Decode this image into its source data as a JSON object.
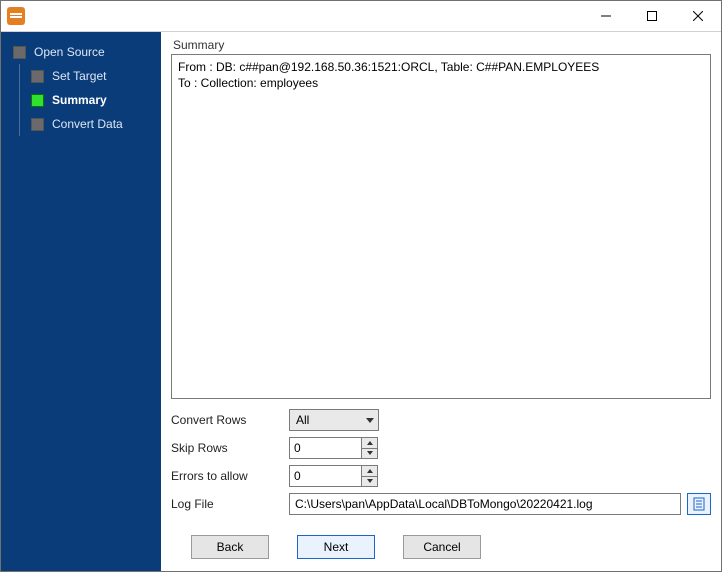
{
  "sidebar": {
    "items": [
      {
        "label": "Open Source"
      },
      {
        "label": "Set Target"
      },
      {
        "label": "Summary"
      },
      {
        "label": "Convert Data"
      }
    ],
    "active_index": 2
  },
  "main": {
    "section_title": "Summary",
    "summary_lines": {
      "from": "From : DB: c##pan@192.168.50.36:1521:ORCL, Table: C##PAN.EMPLOYEES",
      "to": "To : Collection: employees"
    },
    "form": {
      "convert_rows": {
        "label": "Convert Rows",
        "value": "All"
      },
      "skip_rows": {
        "label": "Skip Rows",
        "value": "0"
      },
      "errors_to_allow": {
        "label": "Errors to allow",
        "value": "0"
      },
      "log_file": {
        "label": "Log File",
        "value": "C:\\Users\\pan\\AppData\\Local\\DBToMongo\\20220421.log"
      }
    }
  },
  "footer": {
    "back": "Back",
    "next": "Next",
    "cancel": "Cancel"
  }
}
